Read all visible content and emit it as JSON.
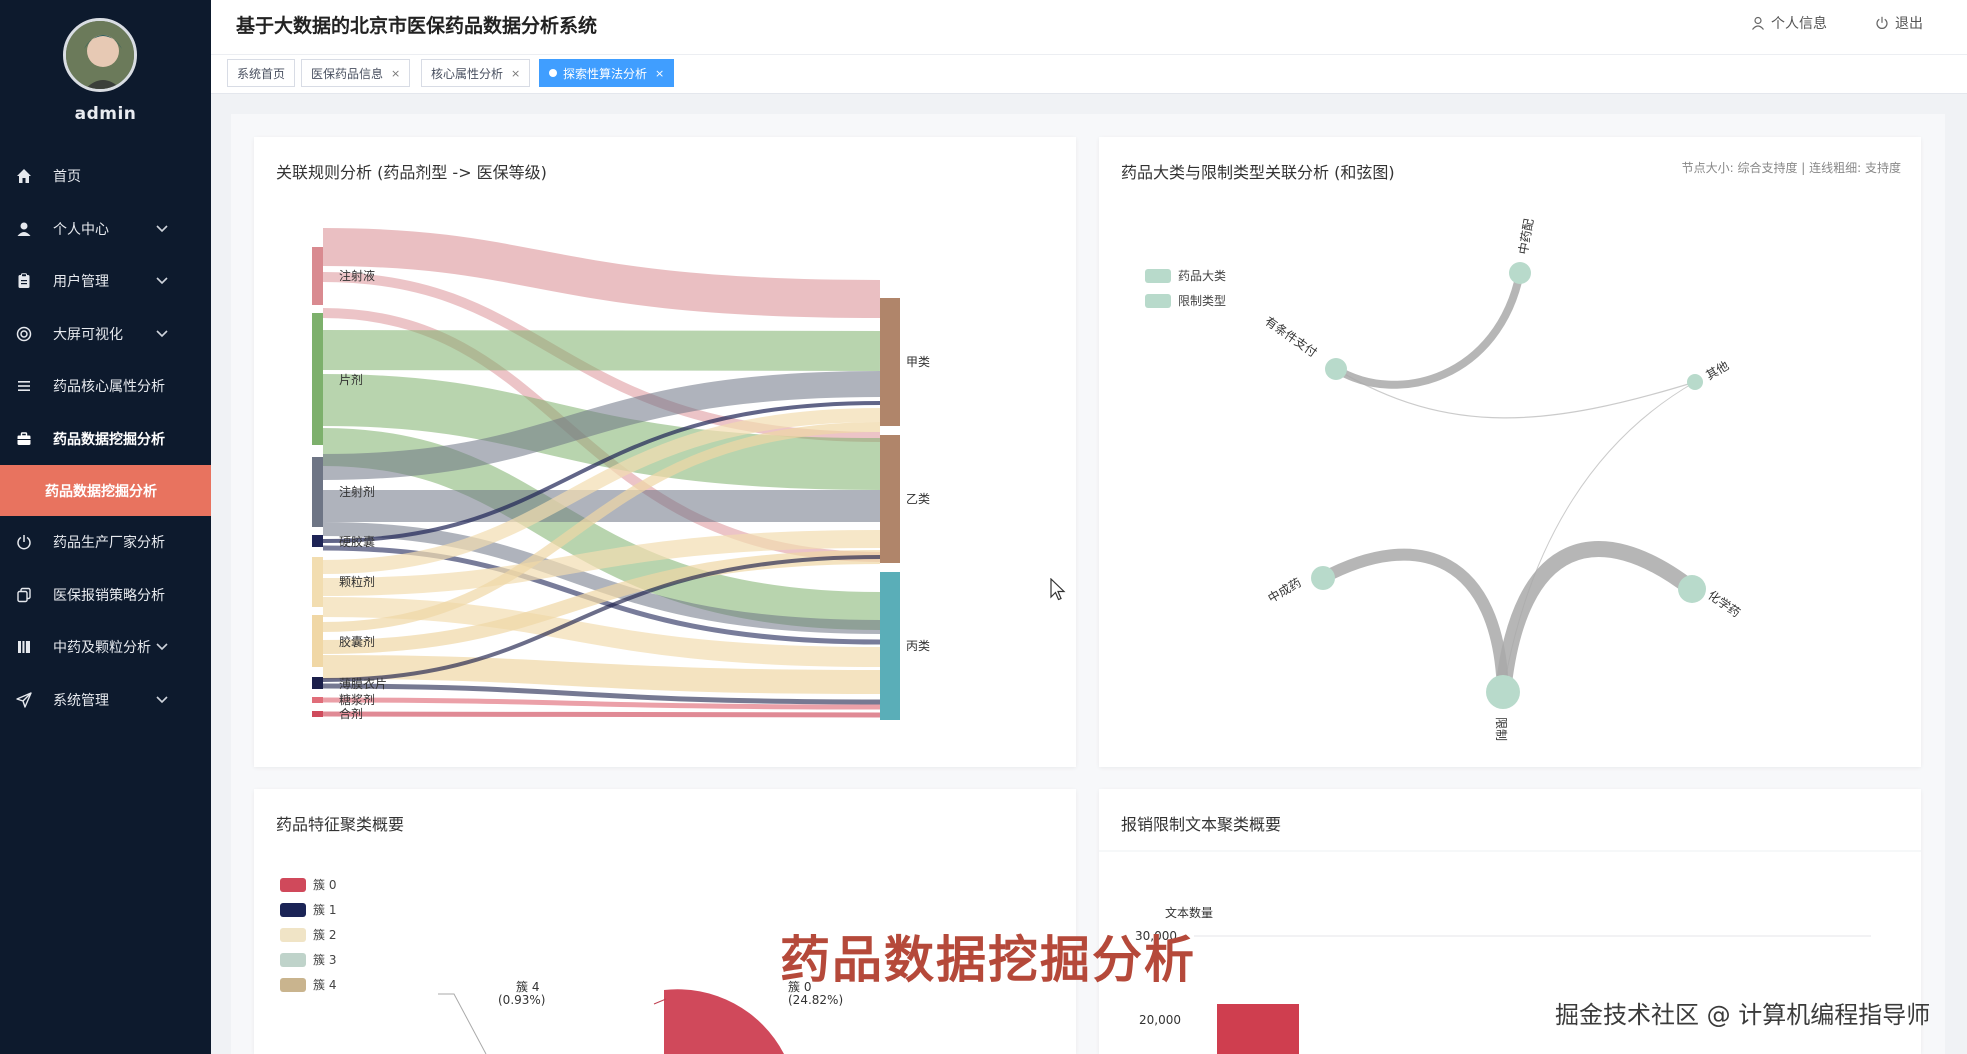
{
  "app": {
    "title": "基于大数据的北京市医保药品数据分析系统"
  },
  "user": {
    "name": "admin"
  },
  "header": {
    "profile_label": "个人信息",
    "logout_label": "退出"
  },
  "sidebar": {
    "items": [
      {
        "label": "首页",
        "icon": "home-icon",
        "has_submenu": false
      },
      {
        "label": "个人中心",
        "icon": "user-icon",
        "has_submenu": true
      },
      {
        "label": "用户管理",
        "icon": "clipboard-icon",
        "has_submenu": true
      },
      {
        "label": "大屏可视化",
        "icon": "lifebuoy-icon",
        "has_submenu": true
      },
      {
        "label": "药品核心属性分析",
        "icon": "list-icon",
        "has_submenu": false
      },
      {
        "label": "药品数据挖掘分析",
        "icon": "briefcase-icon",
        "has_submenu": false
      },
      {
        "label": "药品数据挖掘分析",
        "icon": "",
        "has_submenu": false
      },
      {
        "label": "药品生产厂家分析",
        "icon": "power-icon",
        "has_submenu": false
      },
      {
        "label": "医保报销策略分析",
        "icon": "copy-icon",
        "has_submenu": false
      },
      {
        "label": "中药及颗粒分析",
        "icon": "book-icon",
        "has_submenu": true
      },
      {
        "label": "系统管理",
        "icon": "send-icon",
        "has_submenu": true
      }
    ]
  },
  "tabs": [
    {
      "label": "系统首页",
      "closable": false,
      "active": false
    },
    {
      "label": "医保药品信息",
      "closable": true,
      "active": false
    },
    {
      "label": "核心属性分析",
      "closable": true,
      "active": false
    },
    {
      "label": "探索性算法分析",
      "closable": true,
      "active": true
    }
  ],
  "cards": {
    "sankey": {
      "title": "关联规则分析 (药品剂型 -> 医保等级)"
    },
    "chord": {
      "title": "药品大类与限制类型关联分析 (和弦图)",
      "note": "节点大小: 综合支持度 | 连线粗细: 支持度"
    },
    "cluster": {
      "title": "药品特征聚类概要"
    },
    "text_cluster": {
      "title": "报销限制文本聚类概要",
      "y_axis_name": "文本数量",
      "tick_20000": "20,000",
      "tick_top": "30,000"
    }
  },
  "chart_data": [
    {
      "type": "sankey",
      "title": "关联规则分析 (药品剂型 -> 医保等级)",
      "sources": [
        "注射液",
        "片剂",
        "注射剂",
        "硬胶囊",
        "颗粒剂",
        "胶囊剂",
        "薄膜衣片",
        "糖浆剂",
        "合剂"
      ],
      "targets": [
        "甲类",
        "乙类",
        "丙类"
      ],
      "colors": {
        "注射液": "#d98a90",
        "片剂": "#7db06c",
        "注射剂": "#6e7585",
        "硬胶囊": "#1e2456",
        "颗粒剂": "#f2ddb0",
        "胶囊剂": "#f0d7a5",
        "薄膜衣片": "#1b1f4a",
        "糖浆剂": "#e06d79",
        "合剂": "#cf4b5c",
        "甲类": "#b0856a",
        "乙类": "#b0856a",
        "丙类": "#5aaeb8"
      }
    },
    {
      "type": "chord",
      "title": "药品大类与限制类型关联分析 (和弦图)",
      "legend": [
        "药品大类",
        "限制类型"
      ],
      "nodes": [
        "中药配",
        "有条件支付",
        "其他",
        "中成药",
        "化学药",
        "限制"
      ]
    },
    {
      "type": "pie",
      "title": "药品特征聚类概要",
      "legend": [
        "簇 0",
        "簇 1",
        "簇 2",
        "簇 3",
        "簇 4"
      ],
      "colors": [
        "#d0495b",
        "#1b2456",
        "#f0e4c6",
        "#bfd3ca",
        "#c9b48e"
      ],
      "visible_labels": [
        {
          "name": "簇 4",
          "percent": "(0.93%)"
        },
        {
          "name": "簇 0",
          "percent": "(24.82%)"
        }
      ]
    },
    {
      "type": "bar",
      "title": "报销限制文本聚类概要",
      "ylabel": "文本数量",
      "y_ticks": [
        20000,
        30000
      ],
      "visible_bars": [
        {
          "value": 21000,
          "color": "#cf3e4f"
        }
      ]
    }
  ],
  "overlay": {
    "caption": "药品数据挖掘分析",
    "credit": "掘金技术社区 @ 计算机编程指导师"
  }
}
